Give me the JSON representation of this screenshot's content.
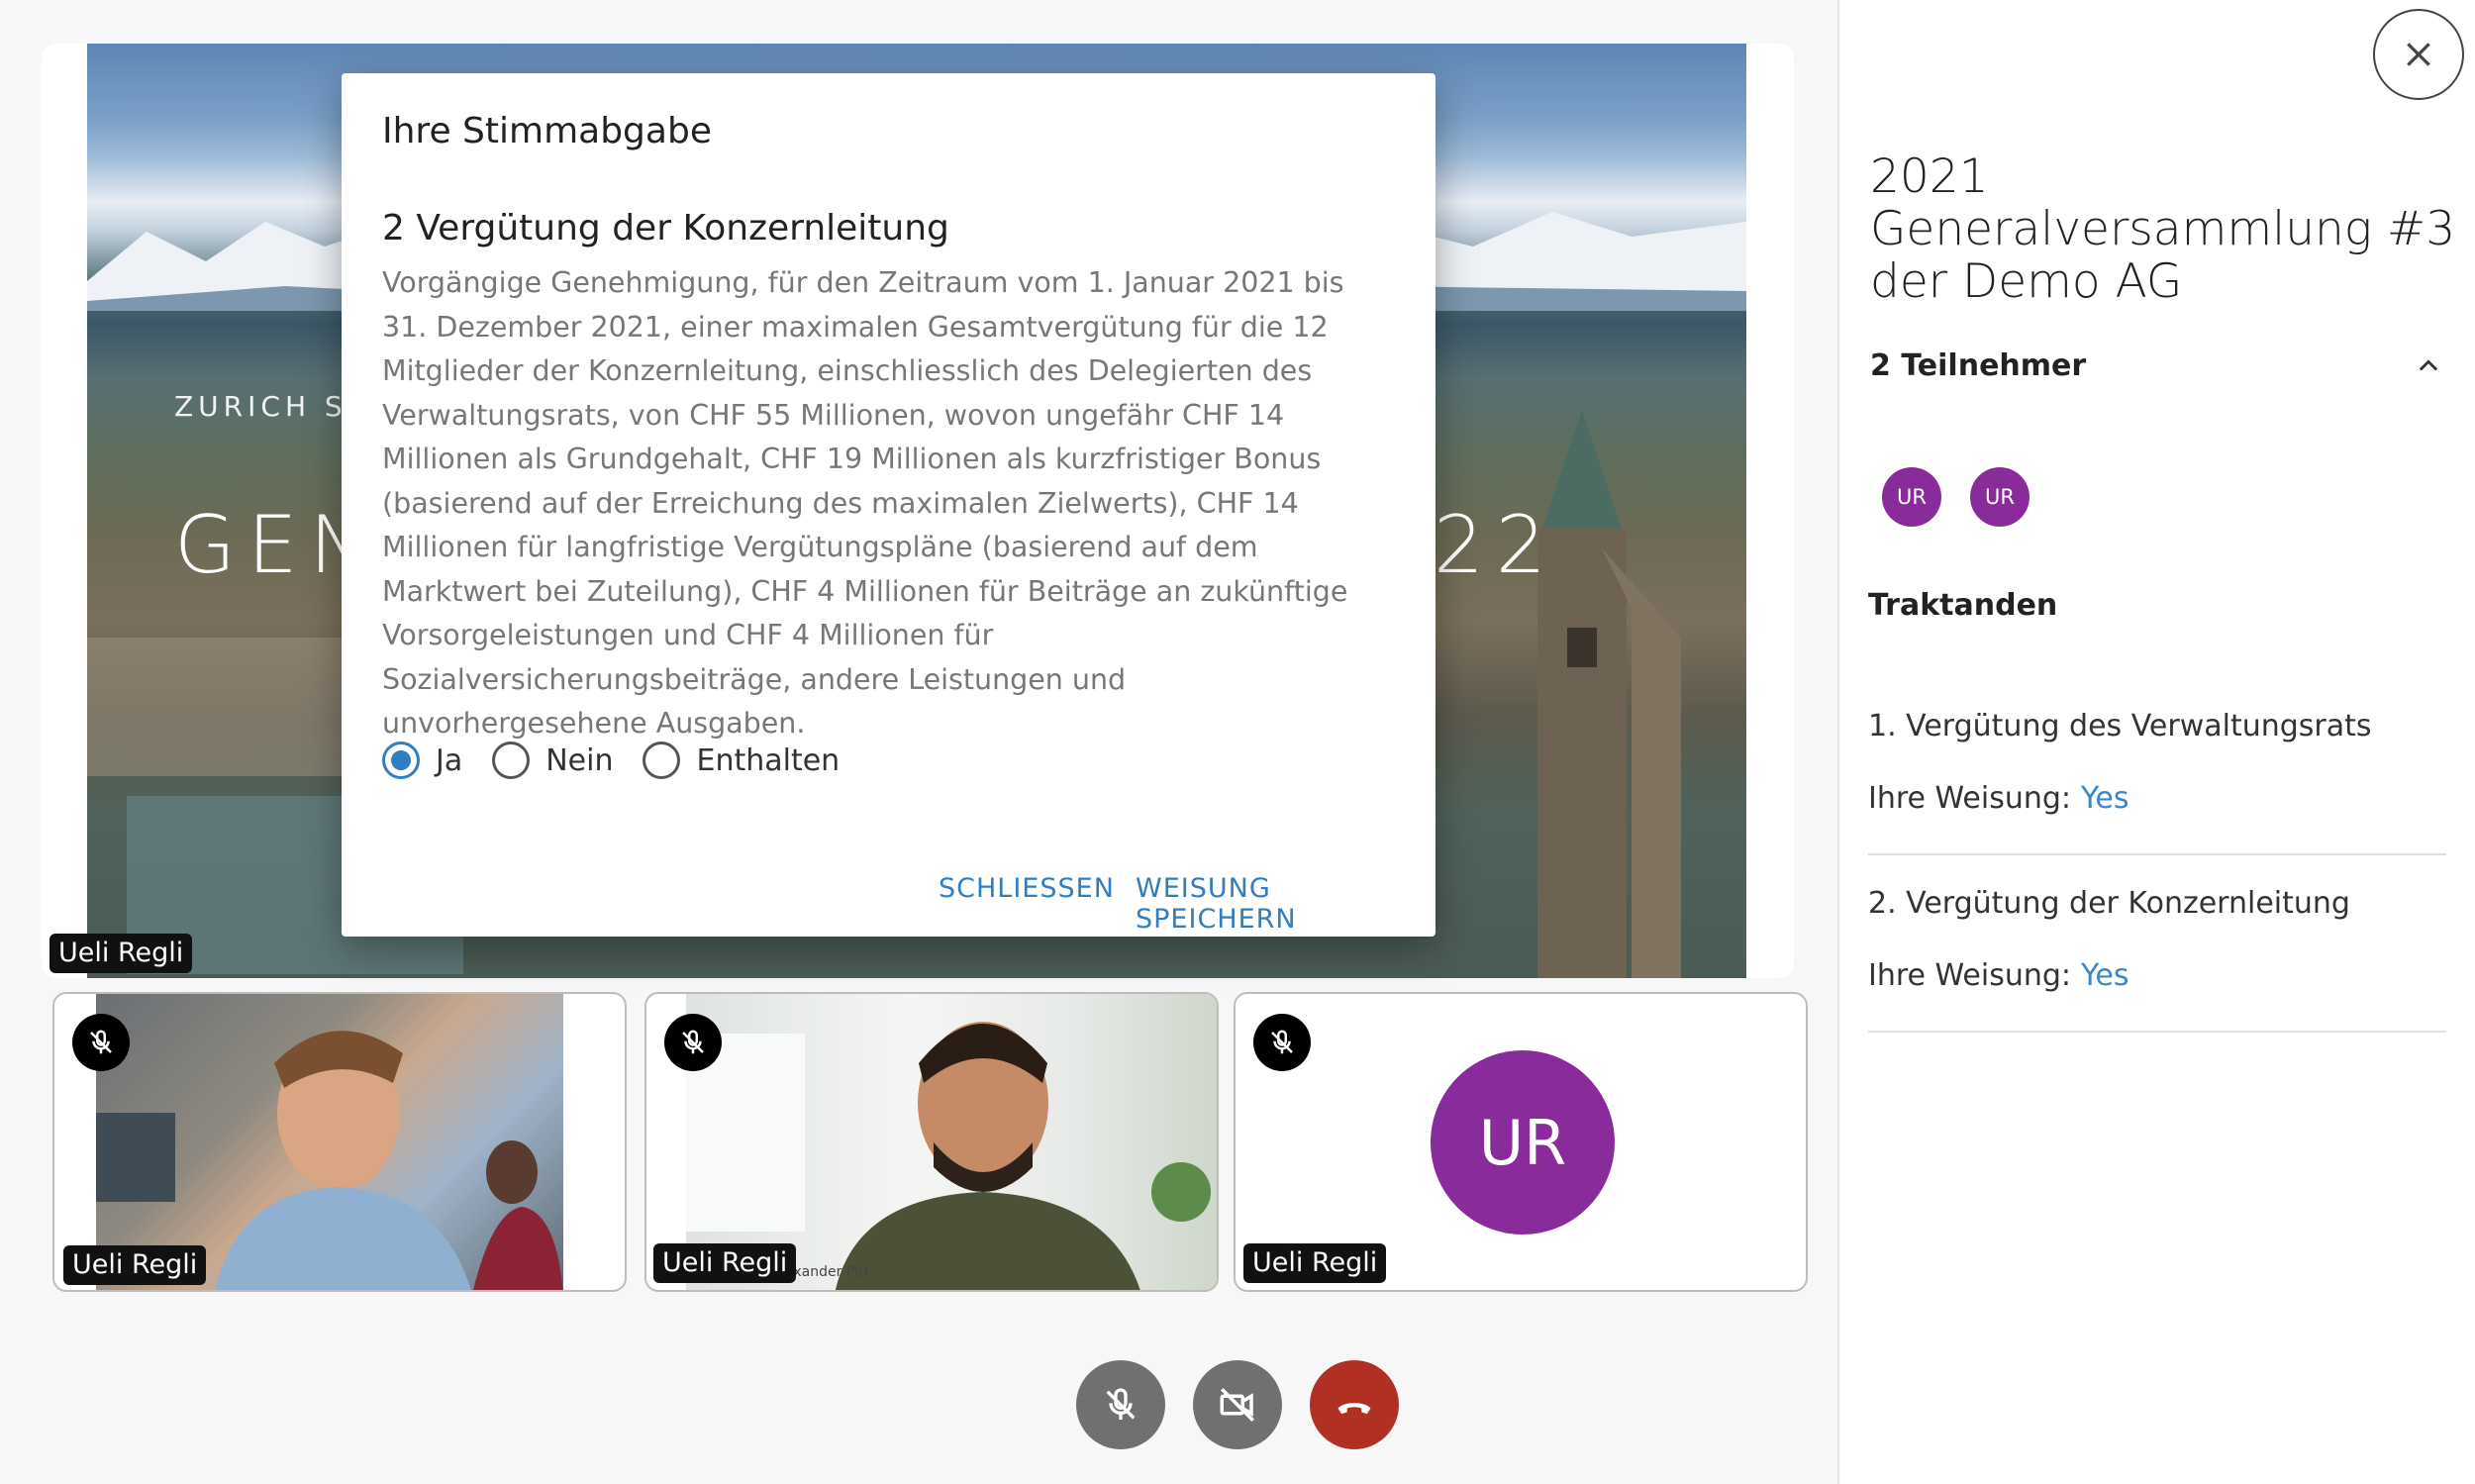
{
  "presentation": {
    "subtitle": "ZURICH SH",
    "title_left": "GEN",
    "title_right": "22",
    "speaker": "Ueli Regli"
  },
  "thumbnails": [
    {
      "name": "Ueli Regli",
      "muted": true,
      "kind": "video"
    },
    {
      "name": "Ueli Regli",
      "muted": true,
      "kind": "video",
      "watermark": "exander Pitt"
    },
    {
      "name": "Ueli Regli",
      "muted": true,
      "kind": "avatar",
      "initials": "UR"
    }
  ],
  "controls": {
    "mic_icon": "mic-off-icon",
    "camera_icon": "video-off-icon",
    "hangup_icon": "phone-hangup-icon",
    "hangup_color": "#b03024"
  },
  "modal": {
    "title": "Ihre Stimmabgabe",
    "item_title": "2 Vergütung der Konzernleitung",
    "item_description": "Vorgängige Genehmigung, für den Zeitraum vom 1. Januar 2021 bis 31. Dezember 2021, einer maximalen Gesamtvergütung für die 12 Mitglieder der Konzernleitung, einschliesslich des Delegierten des Verwaltungsrats, von CHF 55 Millionen, wovon ungefähr CHF 14 Millionen als Grundgehalt, CHF 19 Millionen als kurzfristiger Bonus (basierend auf der Erreichung des maximalen Zielwerts), CHF 14 Millionen für langfristige Vergütungspläne (basierend auf dem Marktwert bei Zuteilung), CHF 4 Millionen für Beiträge an zukünftige Vorsorgeleistungen und CHF 4 Millionen für Sozialversicherungsbeiträge, andere Leistungen und unvorhergesehene Ausgaben.",
    "options": [
      {
        "label": "Ja",
        "selected": true
      },
      {
        "label": "Nein",
        "selected": false
      },
      {
        "label": "Enthalten",
        "selected": false
      }
    ],
    "close_label": "SCHLIESSEN",
    "save_label": "WEISUNG SPEICHERN",
    "accent_color": "#2f7ec1"
  },
  "sidebar": {
    "meeting_title": "2021 Generalversammlung #3 der Demo AG",
    "participants_label": "2 Teilnehmer",
    "participants": [
      "UR",
      "UR"
    ],
    "agenda_label": "Traktanden",
    "agenda": [
      {
        "title": "1. Vergütung des Verwaltungsrats",
        "weisung_label": "Ihre Weisung:",
        "weisung_value": "Yes"
      },
      {
        "title": "2. Vergütung der Konzernleitung",
        "weisung_label": "Ihre Weisung:",
        "weisung_value": "Yes"
      }
    ],
    "avatar_color": "#8a2b9b"
  }
}
